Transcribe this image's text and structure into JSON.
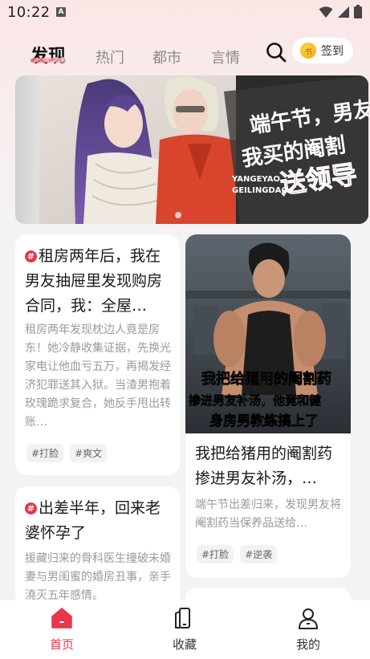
{
  "status_bar": {
    "time": "10:22",
    "notification_icon": "A"
  },
  "top_nav": {
    "tabs": [
      {
        "label": "发现",
        "active": true
      },
      {
        "label": "热门",
        "active": false
      },
      {
        "label": "都市",
        "active": false
      },
      {
        "label": "言情",
        "active": false
      }
    ],
    "checkin_label": "签到",
    "coin_glyph": "书"
  },
  "banner": {
    "text_line1": "端午节，男友",
    "text_line2": "我买的阉割",
    "text_line3": "送领导",
    "text_small1": "YANGEYAO",
    "text_small2": "GEILINGDAO",
    "dots": 2,
    "active_dot": 1
  },
  "cards": [
    {
      "title": "租房两年后，我在男友抽屉里发现购房合同，我：全屋…",
      "desc": "租房两年发现枕边人竟是房东！她冷静收集证据，先换光家电让他血亏五万，再揭发经济犯罪送其入狱。当渣男抱着玫瑰跪求复合，她反手甩出转账…",
      "tags": [
        "#打脸",
        "#爽文"
      ]
    },
    {
      "cover_text_line1": "我把给猪用的阉割药",
      "cover_text_line2": "掺进男友补汤，他竟和健",
      "cover_text_line3": "身房男教练搞上了",
      "title": "我把给猪用的阉割药掺进男友补汤，…",
      "desc": "端午节出差归来，发现男友将阉割药当保养品送给…",
      "tags": [
        "#打脸",
        "#逆袭"
      ]
    },
    {
      "title": "出差半年，回来老婆怀孕了",
      "desc": "援藏归来的骨科医生撞破未婚妻与男闺蜜的婚房丑事，亲手澆灭五年感情。"
    }
  ],
  "bottom_nav": [
    {
      "label": "首页",
      "icon": "home-icon",
      "active": true
    },
    {
      "label": "收藏",
      "icon": "bookshelf-icon",
      "active": false
    },
    {
      "label": "我的",
      "icon": "profile-icon",
      "active": false
    }
  ],
  "colors": {
    "accent": "#e8364a",
    "background": "#f3f3f3",
    "tag_bg": "#f2f2f2"
  }
}
